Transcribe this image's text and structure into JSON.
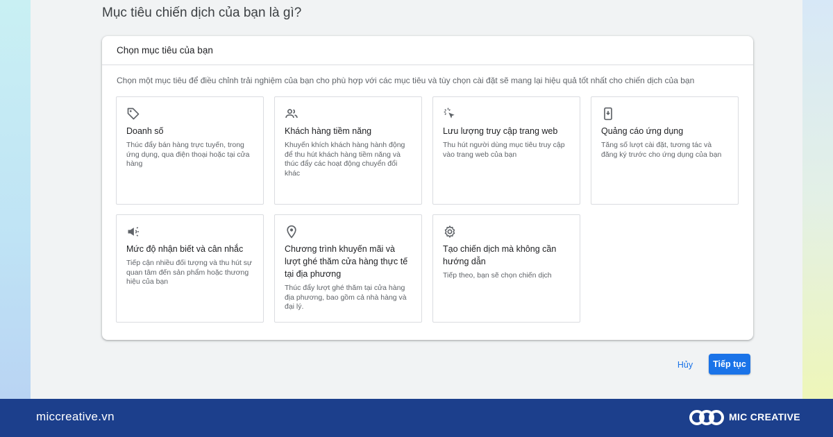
{
  "page": {
    "title": "Mục tiêu chiến dịch của bạn là gì?"
  },
  "panel": {
    "header": "Chọn mục tiêu của bạn",
    "description": "Chọn một mục tiêu để điều chỉnh trải nghiệm của bạn cho phù hợp với các mục tiêu và tùy chọn cài đặt sẽ mang lại hiệu quả tốt nhất cho chiến dịch của bạn"
  },
  "goals": [
    {
      "icon": "tag-icon",
      "title": "Doanh số",
      "desc": "Thúc đẩy bán hàng trực tuyến, trong ứng dụng, qua điện thoại hoặc tại cửa hàng"
    },
    {
      "icon": "people-icon",
      "title": "Khách hàng tiềm năng",
      "desc": "Khuyến khích khách hàng hành động để thu hút khách hàng tiềm năng và thúc đẩy các hoạt động chuyển đổi khác"
    },
    {
      "icon": "cursor-click-icon",
      "title": "Lưu lượng truy cập trang web",
      "desc": "Thu hút người dùng mục tiêu truy cập vào trang web của bạn"
    },
    {
      "icon": "phone-download-icon",
      "title": "Quảng cáo ứng dụng",
      "desc": "Tăng số lượt cài đặt, tương tác và đăng ký trước cho ứng dụng của bạn"
    },
    {
      "icon": "megaphone-icon",
      "title": "Mức độ nhận biết và cân nhắc",
      "desc": "Tiếp cận nhiều đối tượng và thu hút sự quan tâm đến sản phẩm hoặc thương hiệu của bạn"
    },
    {
      "icon": "location-pin-icon",
      "title": "Chương trình khuyến mãi và lượt ghé thăm cửa hàng thực tế tại địa phương",
      "desc": "Thúc đẩy lượt ghé thăm tại cửa hàng địa phương, bao gồm cả nhà hàng và đại lý."
    },
    {
      "icon": "gear-icon",
      "title": "Tạo chiến dịch mà không cần hướng dẫn",
      "desc": "Tiếp theo, bạn sẽ chọn chiến dịch"
    }
  ],
  "actions": {
    "cancel": "Hủy",
    "continue": "Tiếp tục"
  },
  "footer": {
    "url": "miccreative.vn",
    "brand": "MIC CREATIVE"
  },
  "colors": {
    "accent": "#1a73e8",
    "footer_bg": "#1c3f8c"
  }
}
